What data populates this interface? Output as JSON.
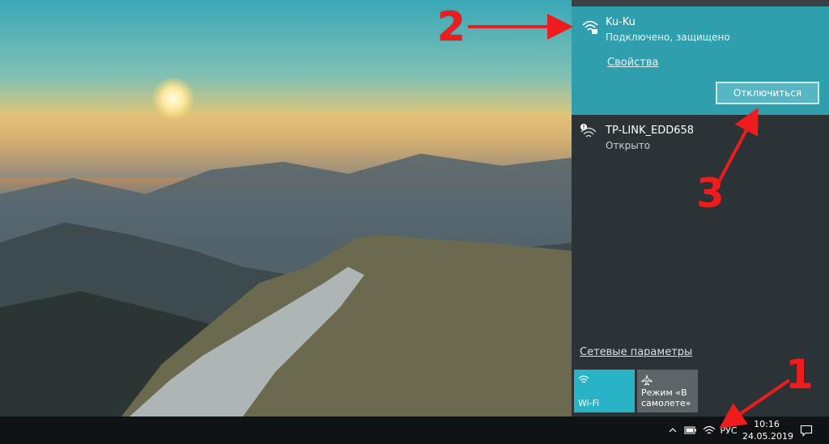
{
  "wallpaper": {
    "description_colors": [
      "#3aa7b8",
      "#f9b24a",
      "#4b5e69"
    ]
  },
  "flyout": {
    "active_network": {
      "name": "Ku-Ku",
      "status": "Подключено, защищено",
      "properties_link": "Свойства",
      "disconnect_button": "Отключиться",
      "icon": "wifi-secured-icon"
    },
    "networks": [
      {
        "name": "TP-LINK_EDD658",
        "status": "Открыто",
        "icon": "wifi-open-warning-icon"
      }
    ],
    "settings_link": "Сетевые параметры",
    "quick_actions": [
      {
        "label": "Wi-Fi",
        "icon": "wifi-icon",
        "state": "on"
      },
      {
        "label": "Режим «В самолете»",
        "icon": "airplane-icon",
        "state": "off"
      }
    ],
    "colors": {
      "active_bg": "#2f9fae",
      "panel_bg": "#2c3336",
      "tile_on": "#29b3c6",
      "tile_off": "#5e6568"
    }
  },
  "taskbar": {
    "tray_icons": [
      "chevron-up-icon",
      "battery-icon",
      "wifi-tray-icon"
    ],
    "language": "РУС",
    "time": "10:16",
    "date": "24.05.2019",
    "notification_icon": "action-center-icon"
  },
  "annotations": [
    {
      "label": "1",
      "color": "#ee1c1c"
    },
    {
      "label": "2",
      "color": "#ee1c1c"
    },
    {
      "label": "3",
      "color": "#ee1c1c"
    }
  ]
}
